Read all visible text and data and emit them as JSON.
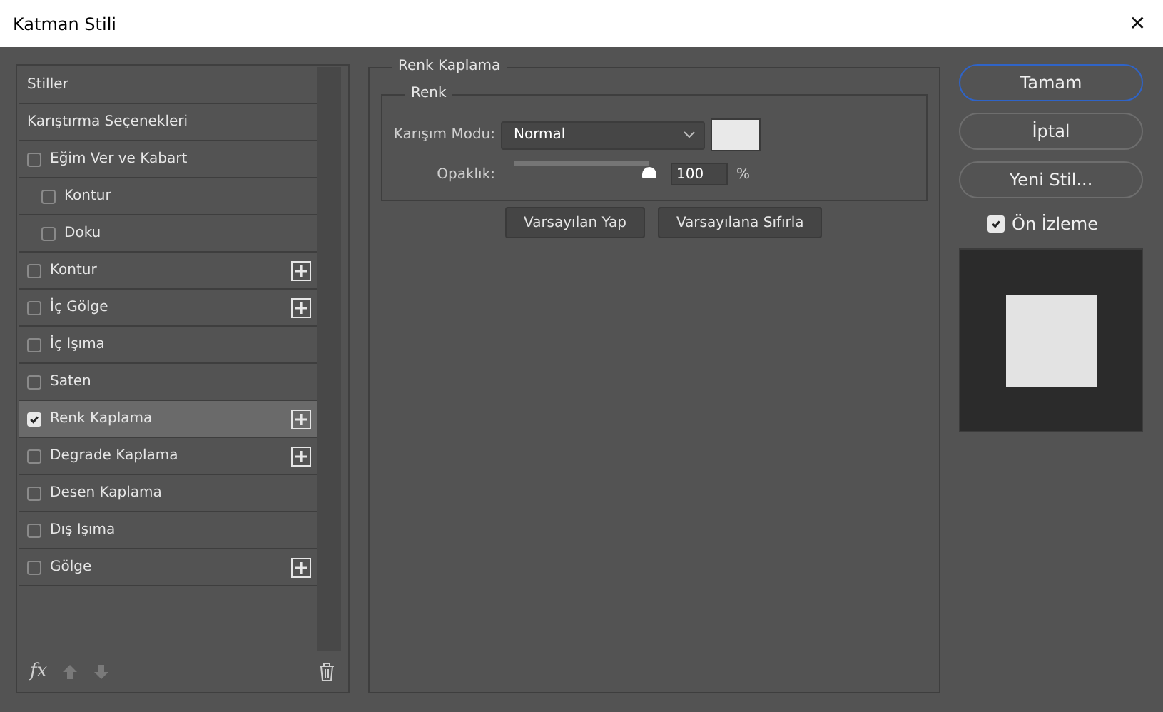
{
  "window": {
    "title": "Katman Stili",
    "close": "✕"
  },
  "styles": [
    {
      "kind": "header",
      "label": "Stiller",
      "selected": false
    },
    {
      "kind": "header",
      "label": "Karıştırma Seçenekleri",
      "selected": false
    },
    {
      "kind": "style",
      "label": "Eğim Ver ve Kabart",
      "checked": false,
      "selected": false,
      "addable": false,
      "children": [
        {
          "kind": "style",
          "label": "Kontur",
          "checked": false,
          "selected": false,
          "addable": false
        },
        {
          "kind": "style",
          "label": "Doku",
          "checked": false,
          "selected": false,
          "addable": false
        }
      ]
    },
    {
      "kind": "style",
      "label": "Kontur",
      "checked": false,
      "selected": false,
      "addable": true
    },
    {
      "kind": "style",
      "label": "İç Gölge",
      "checked": false,
      "selected": false,
      "addable": true
    },
    {
      "kind": "style",
      "label": "İç Işıma",
      "checked": false,
      "selected": false,
      "addable": false
    },
    {
      "kind": "style",
      "label": "Saten",
      "checked": false,
      "selected": false,
      "addable": false
    },
    {
      "kind": "style",
      "label": "Renk Kaplama",
      "checked": true,
      "selected": true,
      "addable": true
    },
    {
      "kind": "style",
      "label": "Degrade Kaplama",
      "checked": false,
      "selected": false,
      "addable": true
    },
    {
      "kind": "style",
      "label": "Desen Kaplama",
      "checked": false,
      "selected": false,
      "addable": false
    },
    {
      "kind": "style",
      "label": "Dış Işıma",
      "checked": false,
      "selected": false,
      "addable": false
    },
    {
      "kind": "style",
      "label": "Gölge",
      "checked": false,
      "selected": false,
      "addable": true
    }
  ],
  "list_footer": {
    "fx": "fx"
  },
  "panel": {
    "title": "Renk Kaplama",
    "group": "Renk",
    "blend_mode": {
      "label": "Karışım Modu:",
      "value": "Normal"
    },
    "opacity": {
      "label": "Opaklık:",
      "level": 1.0,
      "value": "100",
      "unit": "%"
    },
    "buttons": [
      "Varsayılan Yap",
      "Varsayılana Sıfırla"
    ]
  },
  "actions": [
    {
      "label": "Tamam",
      "primary": true
    },
    {
      "label": "İptal",
      "primary": false
    },
    {
      "label": "Yeni Stil...",
      "primary": false
    }
  ],
  "preview": {
    "label": "Ön İzleme",
    "checked": true
  }
}
